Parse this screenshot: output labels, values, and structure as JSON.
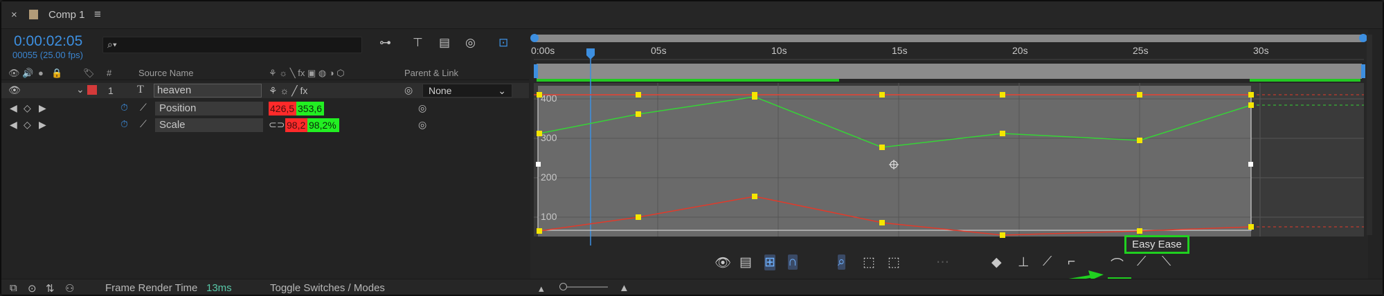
{
  "tab": {
    "close": "×",
    "title": "Comp 1",
    "menu": "≡"
  },
  "time": {
    "code": "0:00:02:05",
    "frames": "00055 (25.00 fps)"
  },
  "search": {
    "icon": "search-icon",
    "placeholder": "⌕▾"
  },
  "columns": {
    "source_name": "Source Name",
    "parent_link": "Parent & Link",
    "hash": "#"
  },
  "layer": {
    "index": "1",
    "type_glyph": "T",
    "name": "heaven",
    "parent": "None",
    "label_color": "#d43a3a"
  },
  "properties": [
    {
      "name": "Position",
      "x": "426,5",
      "y": "353,6"
    },
    {
      "name": "Scale",
      "x": "98,2",
      "y": "98,2%"
    }
  ],
  "ruler": {
    "labels": [
      "0:00s",
      "05s",
      "10s",
      "15s",
      "20s",
      "25s",
      "30s"
    ]
  },
  "graph": {
    "y_labels": [
      "400",
      "300",
      "200",
      "100"
    ]
  },
  "tooltip": "Easy Ease",
  "status": {
    "frame_render_label": "Frame Render Time",
    "frame_render_value": "13ms",
    "toggle": "Toggle Switches / Modes"
  },
  "colors": {
    "accent_blue": "#3d8fe0",
    "red_curve": "#e23a2a",
    "green_curve": "#36d436",
    "keyframe": "#f5e600",
    "highlight": "#20d020"
  }
}
